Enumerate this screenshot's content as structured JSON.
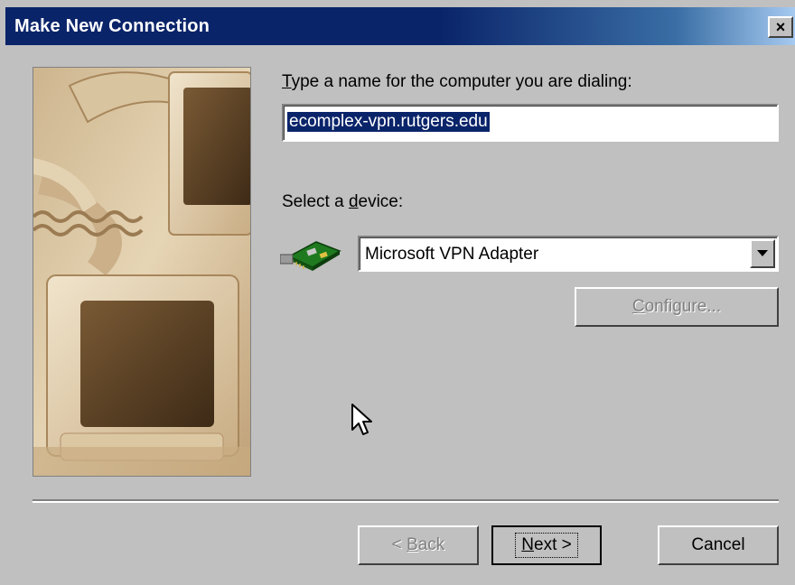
{
  "window": {
    "title": "Make New Connection",
    "close_glyph": "×"
  },
  "computer_name": {
    "label_access": "T",
    "label_rest": "ype a name for the computer you are dialing:",
    "value": "ecomplex-vpn.rutgers.edu"
  },
  "device": {
    "label_before": "Select a ",
    "label_access": "d",
    "label_after": "evice:",
    "selected": "Microsoft VPN Adapter",
    "icon": "network-adapter-icon"
  },
  "buttons": {
    "configure": {
      "access": "C",
      "rest": "onfigure..."
    },
    "back": {
      "prefix": "< ",
      "access": "B",
      "rest": "ack"
    },
    "next": {
      "access": "N",
      "rest": "ext >"
    },
    "cancel": "Cancel"
  },
  "colors": {
    "titlebar": "#0a246a",
    "face": "#c0c0c0",
    "selection": "#0a246a"
  }
}
